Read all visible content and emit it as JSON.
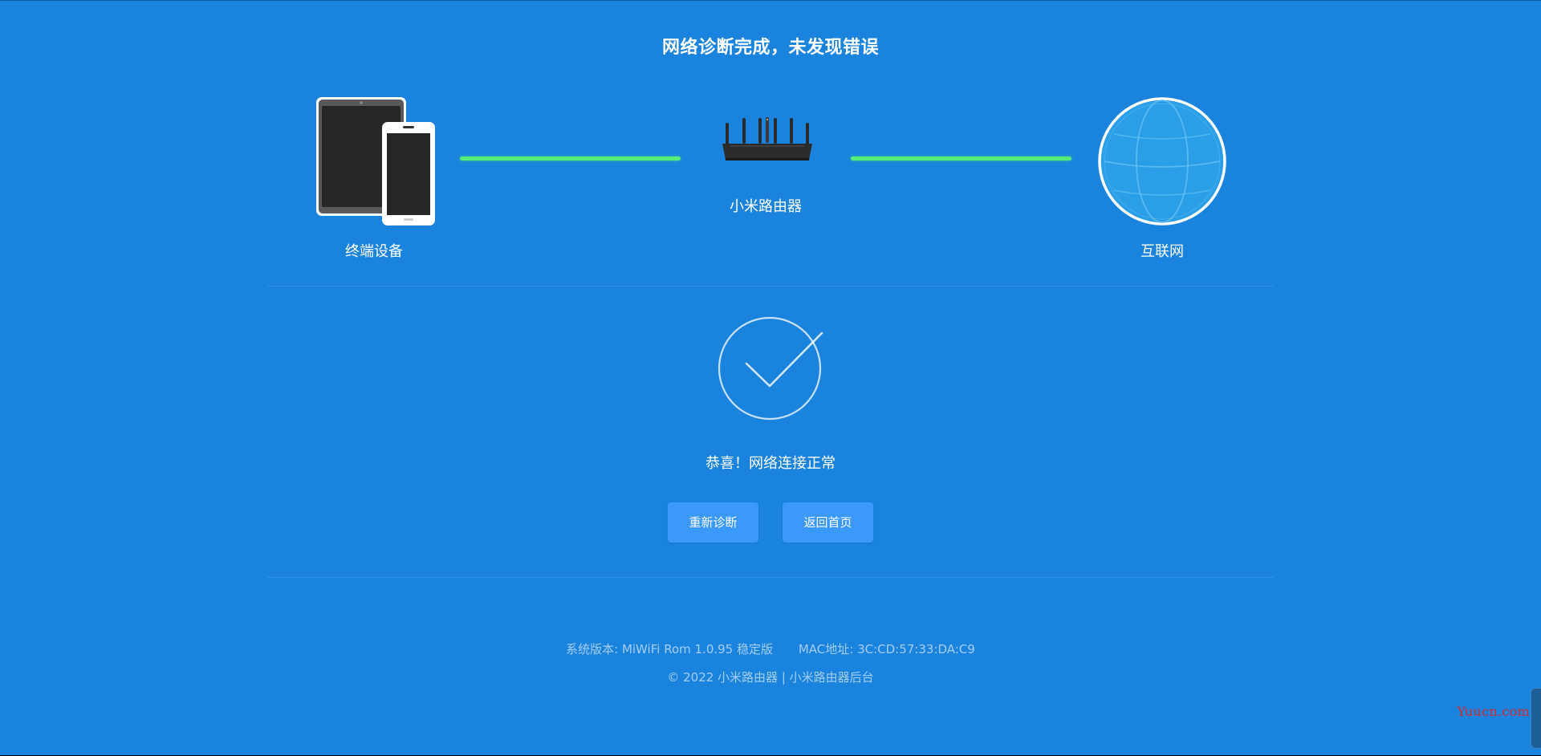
{
  "page": {
    "title": "网络诊断完成，未发现错误"
  },
  "topology": {
    "device_label": "终端设备",
    "router_label": "小米路由器",
    "internet_label": "互联网",
    "link_color": "#56ec78"
  },
  "result": {
    "message": "恭喜！网络连接正常",
    "icon": "check-circle-icon"
  },
  "actions": {
    "retry_label": "重新诊断",
    "home_label": "返回首页"
  },
  "footer": {
    "version_text": "系统版本: MiWiFi Rom 1.0.95 稳定版",
    "mac_text": "MAC地址: 3C:CD:57:33:DA:C9",
    "copyright_text": "© 2022 小米路由器 | 小米路由器后台"
  },
  "watermark": {
    "text": "Yuucn.com"
  },
  "colors": {
    "background": "#1a83de",
    "button": "#3a99fb",
    "link": "#56ec78"
  }
}
